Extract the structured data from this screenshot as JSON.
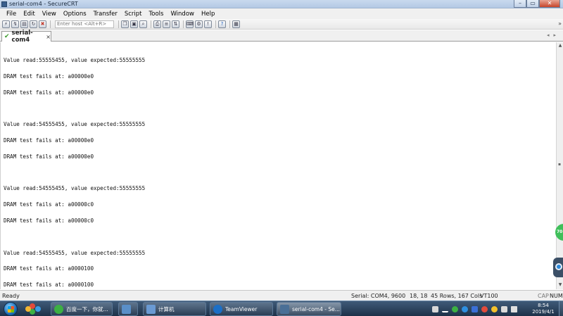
{
  "window": {
    "title": "serial-com4 - SecureCRT",
    "minimize_glyph": "–",
    "maximize_glyph": "▭",
    "close_glyph": "✕"
  },
  "menu": [
    "File",
    "Edit",
    "View",
    "Options",
    "Transfer",
    "Script",
    "Tools",
    "Window",
    "Help"
  ],
  "toolbar": {
    "host_placeholder": "Enter host <Alt+R>",
    "icons_left": [
      "connect-icon",
      "quick-connect-icon",
      "connect-tab-icon",
      "reconnect-icon",
      "disconnect-icon"
    ],
    "icons_right": [
      "copy-icon",
      "paste-icon",
      "find-icon",
      "print-icon",
      "log-session-icon",
      "sftp-icon",
      "key-map-icon",
      "options-icon",
      "help-icon",
      "keypad-icon"
    ]
  },
  "tab": {
    "label": "serial-com4",
    "close_glyph": "×",
    "check_glyph": "✔"
  },
  "terminal": {
    "lines": [
      "Value read:55555455, value expected:55555555",
      "DRAM test fails at: a00000e0",
      "DRAM test fails at: a00000e0",
      "",
      "Value read:54555455, value expected:55555555",
      "DRAM test fails at: a00000e0",
      "DRAM test fails at: a00000e0",
      "",
      "Value read:54555455, value expected:55555555",
      "DRAM test fails at: a00000c0",
      "DRAM test fails at: a00000c0",
      "",
      "Value read:54555455, value expected:55555555",
      "DRAM test fails at: a0000100",
      "DRAM test fails at: a0000100"
    ]
  },
  "statusbar": {
    "status": "Ready",
    "serial": "Serial: COM4, 9600",
    "position": "18,  18",
    "size": "45 Rows, 167 Cols",
    "terminal_type": "VT100",
    "cap": "CAP",
    "num": "NUM"
  },
  "side_badge": {
    "value": "70"
  },
  "taskbar": {
    "tasks": [
      {
        "label": "百度一下，你就...",
        "icon_color": "#3cb043"
      },
      {
        "label": "",
        "icon_color": "#5a8fc8"
      },
      {
        "label": "计算机",
        "icon_color": "#6a9ad3"
      },
      {
        "label": "TeamViewer",
        "icon_color": "#1b6fc7"
      },
      {
        "label": "serial-com4 - Se...",
        "icon_color": "#4a6f96"
      }
    ],
    "clock_time": "8:54",
    "clock_date": "2019/4/1"
  }
}
